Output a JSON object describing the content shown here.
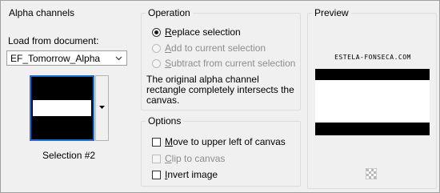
{
  "alpha_channels": {
    "title": "Alpha channels",
    "load_label": "Load from document:",
    "document_value": "EF_Tomorrow_Alpha",
    "selection_caption": "Selection #2"
  },
  "operation": {
    "title": "Operation",
    "options": [
      {
        "label": "Replace selection",
        "selected": true,
        "enabled": true
      },
      {
        "label": "Add to current selection",
        "selected": false,
        "enabled": false
      },
      {
        "label": "Subtract from current selection",
        "selected": false,
        "enabled": false
      }
    ],
    "message": "The original alpha channel rectangle completely intersects the canvas."
  },
  "options": {
    "title": "Options",
    "checks": [
      {
        "label": "Move to upper left of canvas",
        "checked": false,
        "enabled": true
      },
      {
        "label": "Clip to canvas",
        "checked": false,
        "enabled": false
      },
      {
        "label": "Invert image",
        "checked": false,
        "enabled": true
      }
    ]
  },
  "preview": {
    "title": "Preview",
    "watermark": "ESTELA-FONSECA.COM"
  },
  "colors": {
    "accent": "#1e6fd2",
    "panel_bg": "#f0f0f0"
  },
  "icons": {
    "combo_arrow": "chevron-down-icon",
    "dropdown_arrow": "triangle-down-icon",
    "navigator": "checkerboard-navigator-icon"
  }
}
